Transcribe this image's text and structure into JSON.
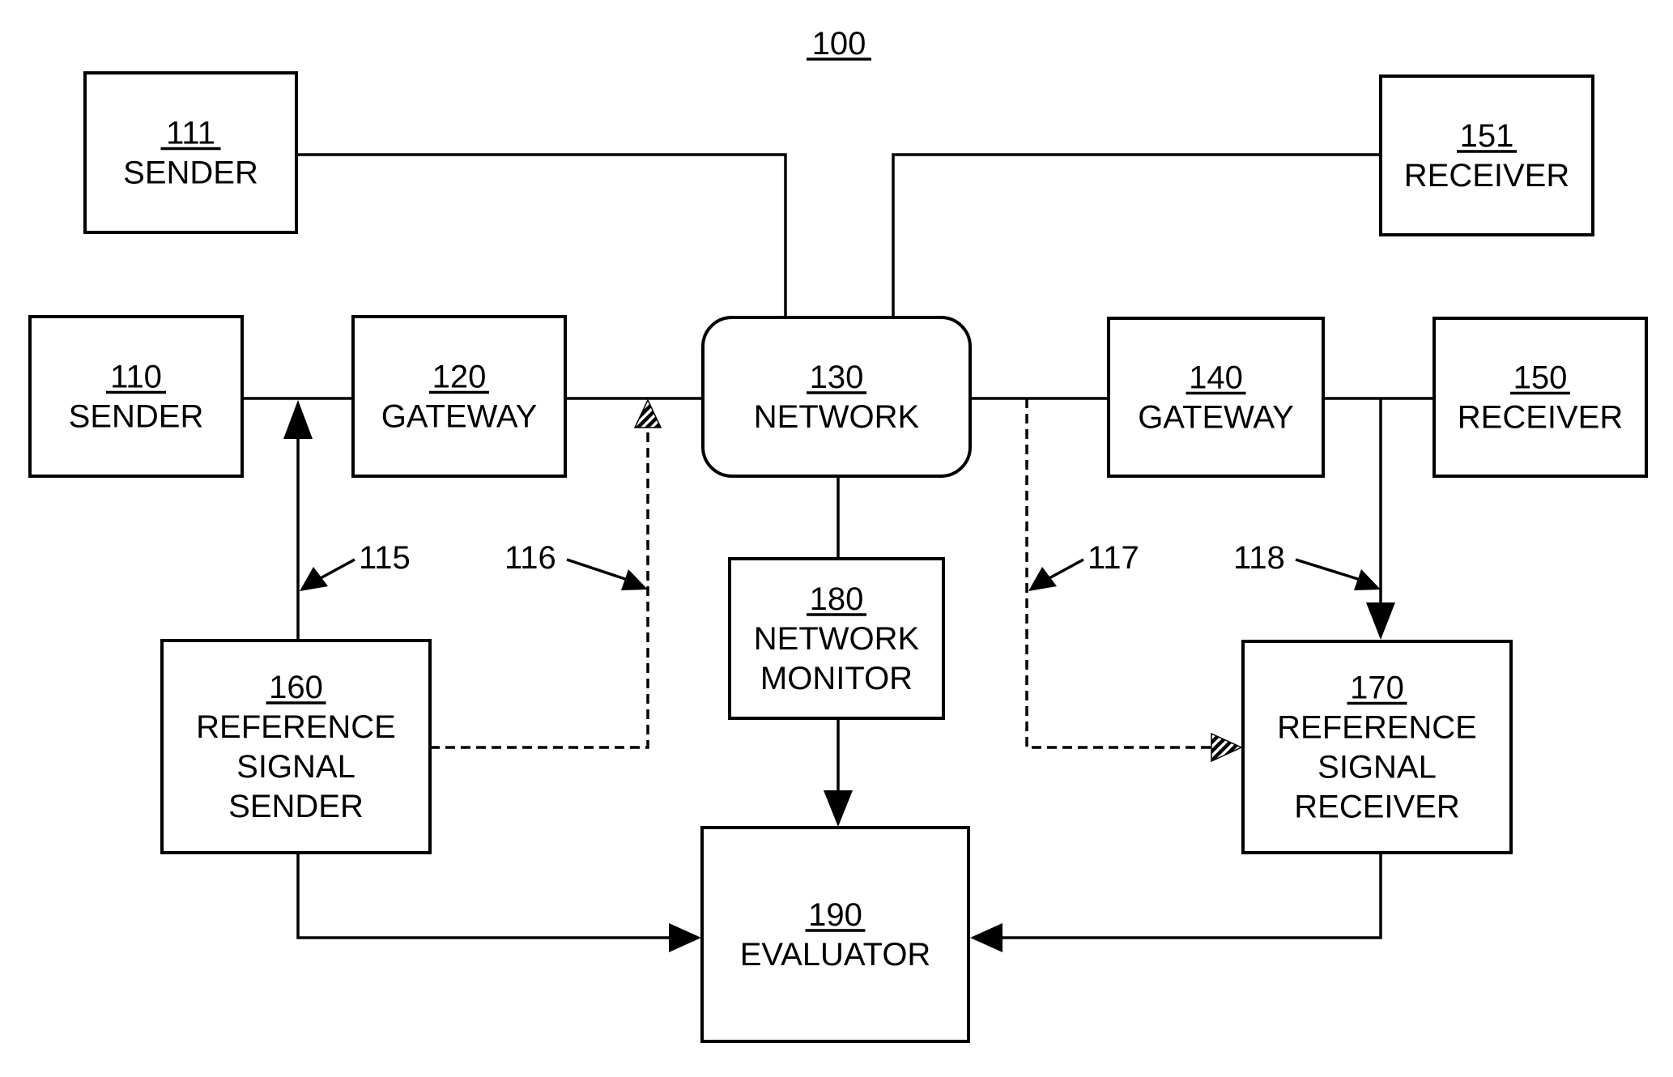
{
  "figure": {
    "number": "100",
    "colors": {
      "ink": "#000000",
      "paper": "#ffffff"
    }
  },
  "blocks": {
    "b111": {
      "number": "111",
      "lines": [
        "SENDER"
      ]
    },
    "b151": {
      "number": "151",
      "lines": [
        "RECEIVER"
      ]
    },
    "b110": {
      "number": "110",
      "lines": [
        "SENDER"
      ]
    },
    "b120": {
      "number": "120",
      "lines": [
        "GATEWAY"
      ]
    },
    "b130": {
      "number": "130",
      "lines": [
        "NETWORK"
      ]
    },
    "b140": {
      "number": "140",
      "lines": [
        "GATEWAY"
      ]
    },
    "b150": {
      "number": "150",
      "lines": [
        "RECEIVER"
      ]
    },
    "b160": {
      "number": "160",
      "lines": [
        "REFERENCE",
        "SIGNAL",
        "SENDER"
      ]
    },
    "b180": {
      "number": "180",
      "lines": [
        "NETWORK",
        "MONITOR"
      ]
    },
    "b170": {
      "number": "170",
      "lines": [
        "REFERENCE",
        "SIGNAL",
        "RECEIVER"
      ]
    },
    "b190": {
      "number": "190",
      "lines": [
        "EVALUATOR"
      ]
    }
  },
  "callouts": {
    "c115": "115",
    "c116": "116",
    "c117": "117",
    "c118": "118"
  }
}
